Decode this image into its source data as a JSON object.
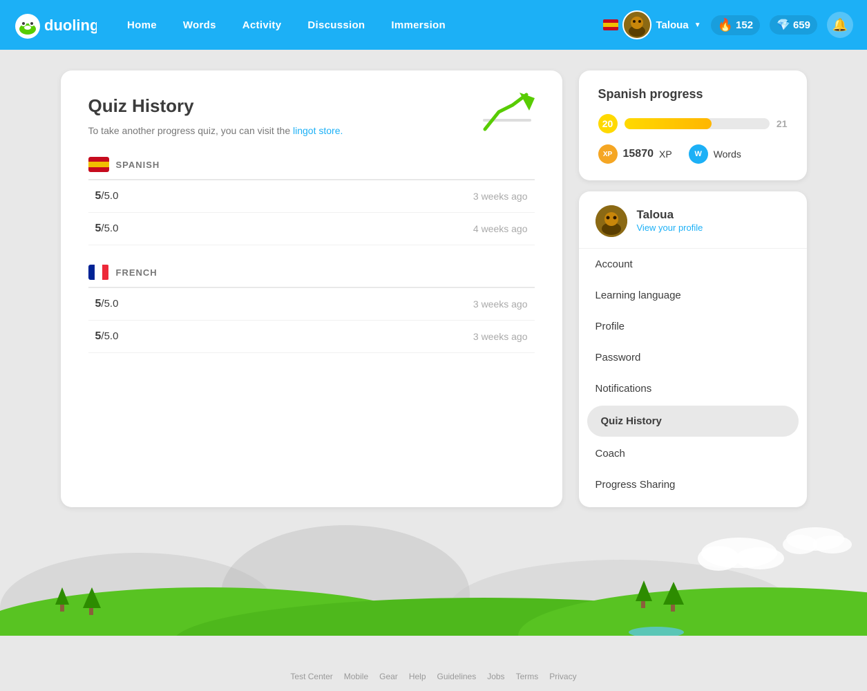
{
  "navbar": {
    "logo_text": "duolingo",
    "links": [
      {
        "label": "Home",
        "id": "home"
      },
      {
        "label": "Words",
        "id": "words"
      },
      {
        "label": "Activity",
        "id": "activity"
      },
      {
        "label": "Discussion",
        "id": "discussion"
      },
      {
        "label": "Immersion",
        "id": "immersion"
      }
    ],
    "user": {
      "name": "Taloua",
      "streak": "152",
      "gems": "659"
    },
    "bell_label": "Notifications"
  },
  "quiz_history": {
    "title": "Quiz History",
    "subtitle": "To take another progress quiz, you can visit the ",
    "link_text": "lingot store.",
    "languages": [
      {
        "name": "SPANISH",
        "scores": [
          {
            "score": "5",
            "total": "/5.0",
            "time": "3 weeks ago"
          },
          {
            "score": "5",
            "total": "/5.0",
            "time": "4 weeks ago"
          }
        ]
      },
      {
        "name": "FRENCH",
        "scores": [
          {
            "score": "5",
            "total": "/5.0",
            "time": "3 weeks ago"
          },
          {
            "score": "5",
            "total": "/5.0",
            "time": "3 weeks ago"
          }
        ]
      }
    ]
  },
  "spanish_progress": {
    "title": "Spanish progress",
    "current_level": "20",
    "next_level": "21",
    "progress_percent": 60,
    "xp_value": "15870",
    "xp_label": "XP",
    "words_label": "Words"
  },
  "profile_menu": {
    "username": "Taloua",
    "view_profile_label": "View your profile",
    "items": [
      {
        "label": "Account",
        "id": "account",
        "active": false
      },
      {
        "label": "Learning language",
        "id": "learning-language",
        "active": false
      },
      {
        "label": "Profile",
        "id": "profile",
        "active": false
      },
      {
        "label": "Password",
        "id": "password",
        "active": false
      },
      {
        "label": "Notifications",
        "id": "notifications",
        "active": false
      },
      {
        "label": "Quiz History",
        "id": "quiz-history",
        "active": true
      },
      {
        "label": "Coach",
        "id": "coach",
        "active": false
      },
      {
        "label": "Progress Sharing",
        "id": "progress-sharing",
        "active": false
      }
    ]
  },
  "footer": {
    "links": [
      "Test Center",
      "Mobile",
      "Gear",
      "Help",
      "Guidelines",
      "Jobs",
      "Terms",
      "Privacy"
    ]
  }
}
